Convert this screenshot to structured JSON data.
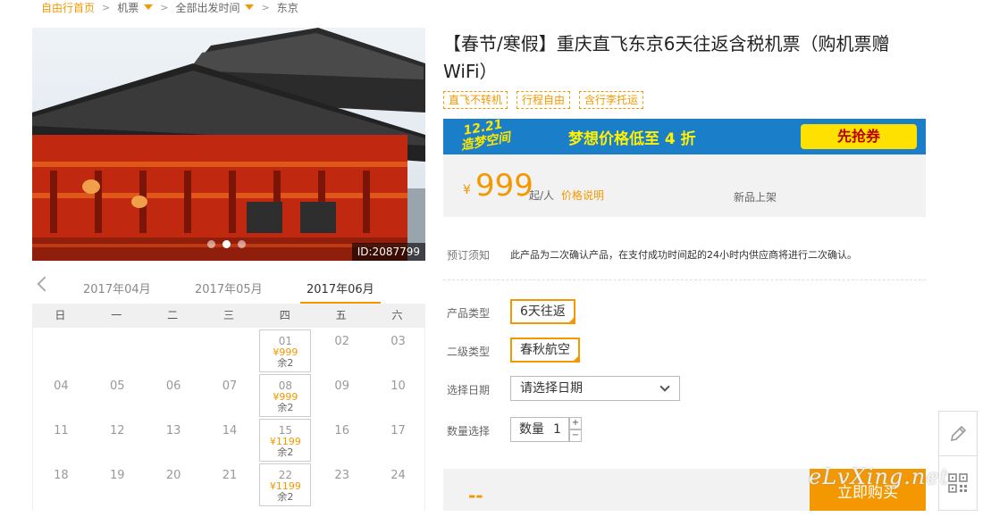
{
  "breadcrumb": {
    "home": "自由行首页",
    "items": [
      "机票",
      "全部出发时间",
      "东京"
    ]
  },
  "photo": {
    "id_label": "ID:2087799",
    "slide_count": 3,
    "active_slide": 2
  },
  "calendar": {
    "months": [
      "2017年04月",
      "2017年05月",
      "2017年06月"
    ],
    "active_month": "2017年06月",
    "weekdays": [
      "日",
      "一",
      "二",
      "三",
      "四",
      "五",
      "六"
    ],
    "rows": [
      [
        {
          "d": ""
        },
        {
          "d": ""
        },
        {
          "d": ""
        },
        {
          "d": ""
        },
        {
          "d": "01",
          "price": "¥999",
          "remain": "余2"
        },
        {
          "d": "02"
        },
        {
          "d": "03"
        }
      ],
      [
        {
          "d": "04"
        },
        {
          "d": "05"
        },
        {
          "d": "06"
        },
        {
          "d": "07"
        },
        {
          "d": "08",
          "price": "¥999",
          "remain": "余2"
        },
        {
          "d": "09"
        },
        {
          "d": "10"
        }
      ],
      [
        {
          "d": "11"
        },
        {
          "d": "12"
        },
        {
          "d": "13"
        },
        {
          "d": "14"
        },
        {
          "d": "15",
          "price": "¥1199",
          "remain": "余2"
        },
        {
          "d": "16"
        },
        {
          "d": "17"
        }
      ],
      [
        {
          "d": "18"
        },
        {
          "d": "19"
        },
        {
          "d": "20"
        },
        {
          "d": "21"
        },
        {
          "d": "22",
          "price": "¥1199",
          "remain": "余2"
        },
        {
          "d": "23"
        },
        {
          "d": "24"
        }
      ]
    ]
  },
  "product": {
    "title": "【春节/寒假】重庆直飞东京6天往返含税机票（购机票赠WiFi）",
    "tags": [
      "直飞不转机",
      "行程自由",
      "含行李托运"
    ],
    "banner": {
      "left": "12.21\n造梦空间",
      "middle": "梦想价格低至 4 折",
      "button": "先抢券"
    },
    "price": {
      "currency": "¥",
      "value": "999",
      "unit": "起/人",
      "link": "价格说明",
      "status": "新品上架"
    },
    "notice_label": "预订须知",
    "notice_text": "此产品为二次确认产品，在支付成功时间起的24小时内供应商将进行二次确认。",
    "type_label": "产品类型",
    "type_value": "6天往返",
    "subtype_label": "二级类型",
    "subtype_value": "春秋航空",
    "date_label": "选择日期",
    "date_placeholder": "请选择日期",
    "qty_label": "数量选择",
    "qty_prefix": "数量",
    "qty_value": "1",
    "bottom_price": "--",
    "buy_label": "立即购买"
  },
  "watermark": "eLvXing.net",
  "colors": {
    "accent": "#f39800",
    "banner_bg": "#1a7ec8"
  }
}
